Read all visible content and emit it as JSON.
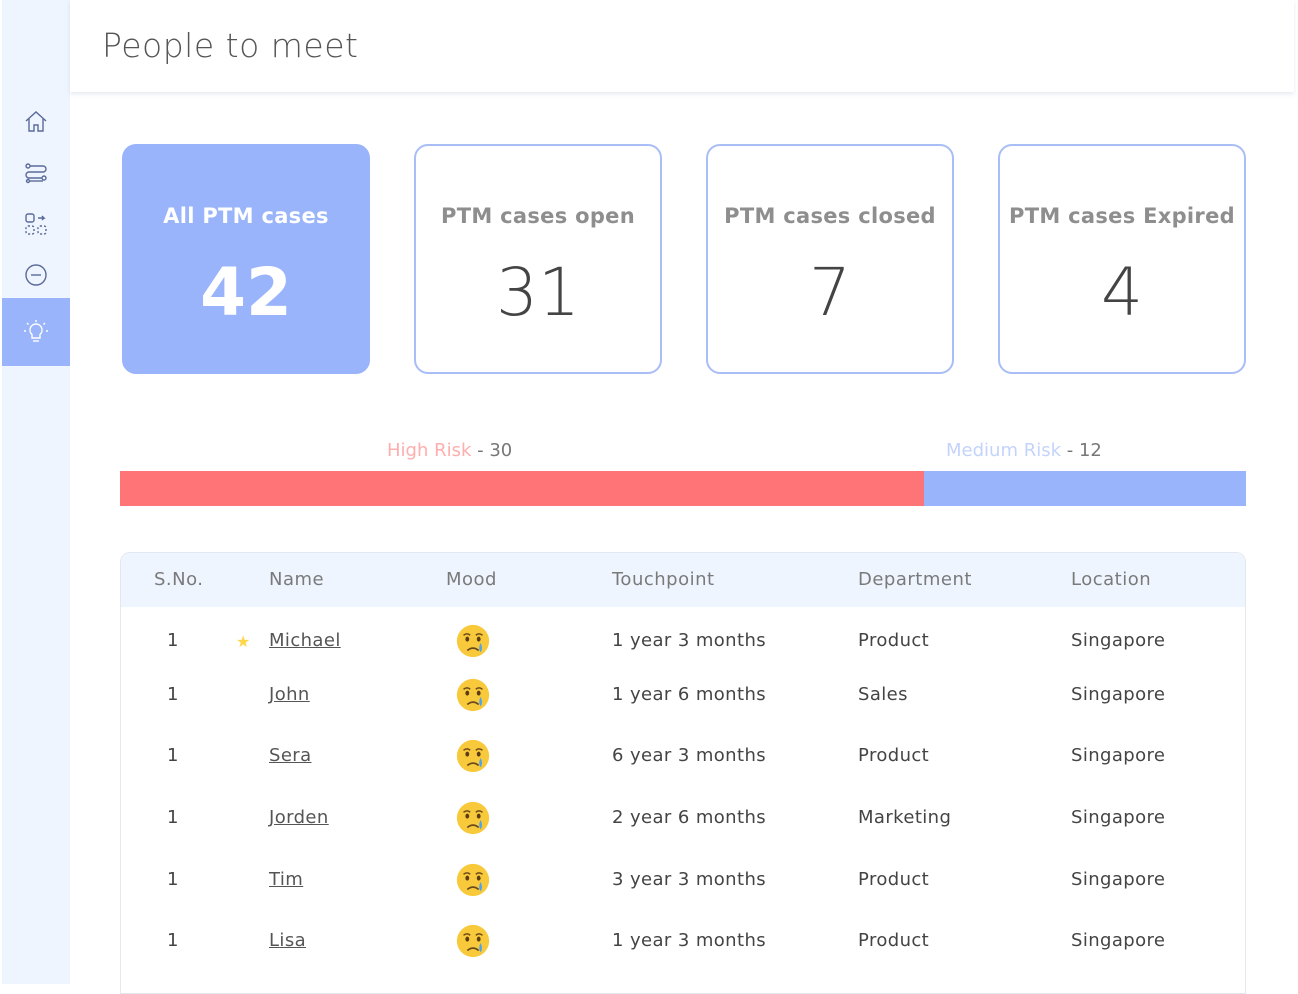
{
  "header": {
    "title": "People to meet"
  },
  "sidebar": {
    "items": [
      {
        "icon": "home-icon"
      },
      {
        "icon": "routes-icon"
      },
      {
        "icon": "switch-icon"
      },
      {
        "icon": "minus-circle-icon"
      },
      {
        "icon": "lightbulb-icon",
        "active": true
      }
    ]
  },
  "stats": [
    {
      "label": "All PTM cases",
      "value": "42"
    },
    {
      "label": "PTM cases open",
      "value": "31"
    },
    {
      "label": "PTM cases closed",
      "value": "7"
    },
    {
      "label": "PTM cases Expired",
      "value": "4"
    }
  ],
  "risk": {
    "high": {
      "label": "High Risk",
      "sep": " - ",
      "value": "30",
      "color": "#ff7577"
    },
    "medium": {
      "label": "Medium Risk",
      "sep": " - ",
      "value": "12",
      "color": "#9ab4fb"
    }
  },
  "table": {
    "columns": [
      "S.No.",
      "Name",
      "Mood",
      "Touchpoint",
      "Department",
      "Location"
    ],
    "rows": [
      {
        "sno": "1",
        "name": "Michael",
        "starred": true,
        "mood": "crying-face-icon",
        "touchpoint": "1 year 3 months",
        "department": "Product",
        "location": "Singapore"
      },
      {
        "sno": "1",
        "name": "John",
        "starred": false,
        "mood": "crying-face-icon",
        "touchpoint": "1 year 6 months",
        "department": "Sales",
        "location": "Singapore"
      },
      {
        "sno": "1",
        "name": "Sera",
        "starred": false,
        "mood": "crying-face-icon",
        "touchpoint": "6 year 3 months",
        "department": "Product",
        "location": "Singapore"
      },
      {
        "sno": "1",
        "name": "Jorden",
        "starred": false,
        "mood": "crying-face-icon",
        "touchpoint": "2 year 6 months",
        "department": "Marketing",
        "location": "Singapore"
      },
      {
        "sno": "1",
        "name": "Tim",
        "starred": false,
        "mood": "crying-face-icon",
        "touchpoint": "3 year 3 months",
        "department": "Product",
        "location": "Singapore"
      },
      {
        "sno": "1",
        "name": "Lisa",
        "starred": false,
        "mood": "crying-face-icon",
        "touchpoint": "1 year 3 months",
        "department": "Product",
        "location": "Singapore"
      }
    ]
  }
}
